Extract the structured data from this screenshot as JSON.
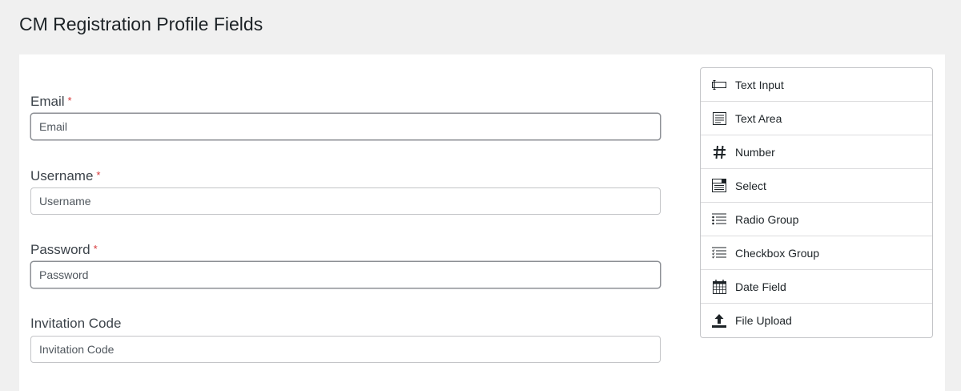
{
  "page": {
    "title": "CM Registration Profile Fields"
  },
  "form": {
    "fields": [
      {
        "label": "Email",
        "required": true,
        "placeholder": "Email"
      },
      {
        "label": "Username",
        "required": true,
        "placeholder": "Username"
      },
      {
        "label": "Password",
        "required": true,
        "placeholder": "Password"
      },
      {
        "label": "Invitation Code",
        "required": false,
        "placeholder": "Invitation Code"
      }
    ],
    "required_marker": "*"
  },
  "palette": {
    "items": [
      {
        "label": "Text Input",
        "icon": "text-input-icon"
      },
      {
        "label": "Text Area",
        "icon": "text-area-icon"
      },
      {
        "label": "Number",
        "icon": "hash-icon"
      },
      {
        "label": "Select",
        "icon": "select-icon"
      },
      {
        "label": "Radio Group",
        "icon": "radio-list-icon"
      },
      {
        "label": "Checkbox Group",
        "icon": "checkbox-list-icon"
      },
      {
        "label": "Date Field",
        "icon": "calendar-icon"
      },
      {
        "label": "File Upload",
        "icon": "upload-icon"
      }
    ]
  },
  "colors": {
    "required": "#d63638",
    "background": "#f0f0f0",
    "panel": "#ffffff"
  }
}
